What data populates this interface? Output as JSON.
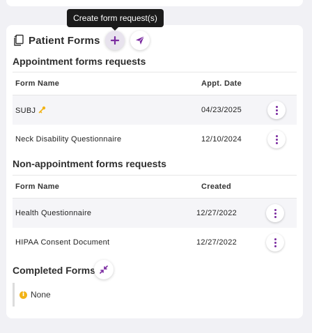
{
  "tooltip": {
    "text": "Create form request(s)"
  },
  "panel": {
    "title": "Patient Forms",
    "icons": {
      "header": "documents-icon",
      "add": "plus-icon",
      "send": "paper-plane-icon"
    }
  },
  "appointment_forms": {
    "title": "Appointment forms requests",
    "columns": {
      "name": "Form Name",
      "date": "Appt. Date"
    },
    "rows": [
      {
        "name": "SUBJ",
        "date": "04/23/2025",
        "icon": "key-icon"
      },
      {
        "name": "Neck Disability Questionnaire",
        "date": "12/10/2024"
      }
    ]
  },
  "non_appointment_forms": {
    "title": "Non-appointment forms requests",
    "columns": {
      "name": "Form Name",
      "date": "Created"
    },
    "rows": [
      {
        "name": "Health Questionnaire",
        "date": "12/27/2022"
      },
      {
        "name": "HIPAA Consent Document",
        "date": "12/27/2022"
      }
    ]
  },
  "completed_forms": {
    "title": "Completed Forms",
    "icon": "collapse-arrows-icon",
    "empty_text": "None",
    "empty_icon": "info-icon"
  },
  "colors": {
    "accent": "#7a2aa0",
    "key": "#f2b316"
  }
}
